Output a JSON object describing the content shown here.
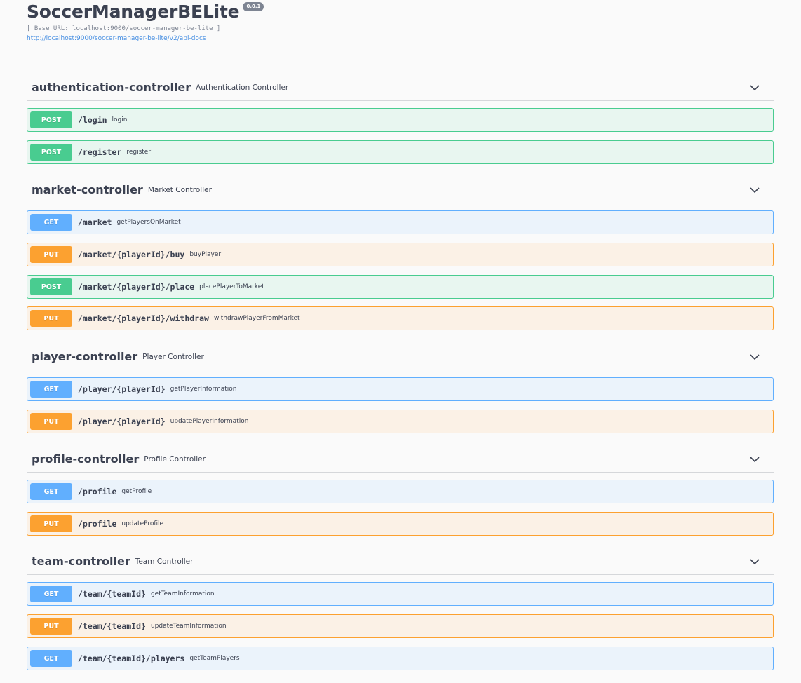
{
  "info": {
    "title": "SoccerManagerBELite",
    "version": "0.0.1",
    "base_url": "[ Base URL: localhost:9000/soccer-manager-be-lite ]",
    "docs_link": "http://localhost:9000/soccer-manager-be-lite/v2/api-docs"
  },
  "tags": [
    {
      "name": "authentication-controller",
      "description": "Authentication Controller",
      "operations": [
        {
          "method": "POST",
          "path": "/login",
          "summary": "login"
        },
        {
          "method": "POST",
          "path": "/register",
          "summary": "register"
        }
      ]
    },
    {
      "name": "market-controller",
      "description": "Market Controller",
      "operations": [
        {
          "method": "GET",
          "path": "/market",
          "summary": "getPlayersOnMarket"
        },
        {
          "method": "PUT",
          "path": "/market/{playerId}/buy",
          "summary": "buyPlayer"
        },
        {
          "method": "POST",
          "path": "/market/{playerId}/place",
          "summary": "placePlayerToMarket"
        },
        {
          "method": "PUT",
          "path": "/market/{playerId}/withdraw",
          "summary": "withdrawPlayerFromMarket"
        }
      ]
    },
    {
      "name": "player-controller",
      "description": "Player Controller",
      "operations": [
        {
          "method": "GET",
          "path": "/player/{playerId}",
          "summary": "getPlayerInformation"
        },
        {
          "method": "PUT",
          "path": "/player/{playerId}",
          "summary": "updatePlayerInformation"
        }
      ]
    },
    {
      "name": "profile-controller",
      "description": "Profile Controller",
      "operations": [
        {
          "method": "GET",
          "path": "/profile",
          "summary": "getProfile"
        },
        {
          "method": "PUT",
          "path": "/profile",
          "summary": "updateProfile"
        }
      ]
    },
    {
      "name": "team-controller",
      "description": "Team Controller",
      "operations": [
        {
          "method": "GET",
          "path": "/team/{teamId}",
          "summary": "getTeamInformation"
        },
        {
          "method": "PUT",
          "path": "/team/{teamId}",
          "summary": "updateTeamInformation"
        },
        {
          "method": "GET",
          "path": "/team/{teamId}/players",
          "summary": "getTeamPlayers"
        }
      ]
    }
  ],
  "colors": {
    "post": "#49cc90",
    "get": "#61affe",
    "put": "#fca130",
    "text": "#3b4151"
  },
  "icons": {
    "tag_toggle": "chevron-down-icon"
  }
}
